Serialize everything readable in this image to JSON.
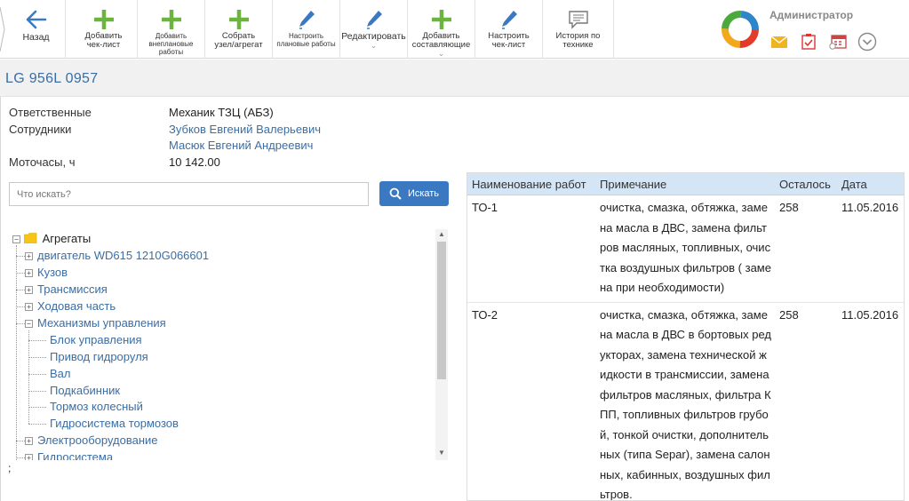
{
  "toolbar": {
    "buttons": [
      {
        "id": "back",
        "label": "Назад",
        "icon": "arrow-left-icon"
      },
      {
        "id": "add-checklist",
        "label": "Добавить чек-лист",
        "icon": "plus-icon"
      },
      {
        "id": "add-unplanned",
        "label": "Добавить внеплановые работы",
        "icon": "plus-icon"
      },
      {
        "id": "assemble",
        "label": "Собрать узел/агрегат",
        "icon": "plus-icon"
      },
      {
        "id": "setup-planned",
        "label": "Настроить плановые работы",
        "icon": "pencil-icon"
      },
      {
        "id": "edit",
        "label": "Редактировать",
        "icon": "pencil-icon"
      },
      {
        "id": "add-components",
        "label": "Добавить составляющие",
        "icon": "plus-icon"
      },
      {
        "id": "setup-checklist",
        "label": "Настроить чек-лист",
        "icon": "pencil-icon"
      },
      {
        "id": "history",
        "label": "История по технике",
        "icon": "comment-icon"
      }
    ]
  },
  "user": {
    "name": "Администратор",
    "icons": [
      "mail-icon",
      "clipboard-check-icon",
      "calendar-icon",
      "chevron-down-circle-icon"
    ]
  },
  "page": {
    "title": "LG 956L 0957"
  },
  "info": {
    "responsible_label": "Ответственные",
    "responsible_value": "Механик ТЗЦ (АБЗ)",
    "employees_label": "Сотрудники",
    "employees": [
      "Зубков Евгений Валерьевич",
      "Масюк Евгений Андреевич"
    ],
    "hours_label": "Моточасы, ч",
    "hours_value": "10 142.00"
  },
  "search": {
    "placeholder": "Что искать?",
    "button_label": "Искать"
  },
  "tree": {
    "root": "Агрегаты",
    "items": [
      "двигатель WD615 1210G066601",
      "Кузов",
      "Трансмиссия",
      "Ходовая часть",
      "Механизмы управления",
      "Блок управления",
      "Привод гидроруля",
      "Вал",
      "Подкабинник",
      "Тормоз колесный",
      "Гидросистема тормозов",
      "Электрооборудование",
      "Гидросистема"
    ]
  },
  "misc": {
    "semicolon": ";"
  },
  "grid": {
    "columns": [
      "Наименование работ",
      "Примечание",
      "Осталось",
      "Дата"
    ],
    "rows": [
      {
        "name": "ТО-1",
        "note": "очистка, смазка, обтяжка, замена масла в ДВС, замена фильтров масляных, топливных, очистка воздушных фильтров ( замена при необходимости)",
        "left": "258",
        "date": "11.05.2016"
      },
      {
        "name": "ТО-2",
        "note": "очистка, смазка, обтяжка, замена масла в ДВС в бортовых редукторах, замена технической жидкости в трансмиссии, замена фильтров масляных, фильтра КПП, топливных фильтров грубой, тонкой очистки, дополнительных (типа Separ), замена салонных, кабинных, воздушных фильтров.",
        "left": "258",
        "date": "11.05.2016"
      }
    ]
  },
  "colors": {
    "accent": "#3a6ea5",
    "header_bg": "#d4e5f6",
    "search_btn": "#3a79c2",
    "plus": "#6cb33f"
  }
}
